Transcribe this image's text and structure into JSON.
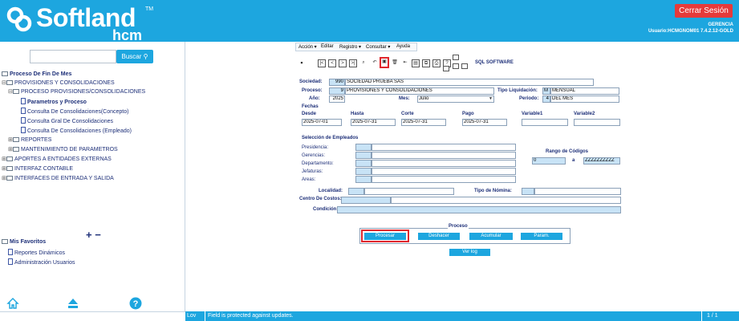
{
  "header": {
    "brand": "Softland",
    "tm": "TM",
    "sub_brand": "hcm",
    "logout_label": "Cerrar Sesión",
    "company": "GERENCIA",
    "user_info": "Usuario:HCMGNOM01 7.4.2.12-GOLD"
  },
  "sidebar": {
    "search_placeholder": "",
    "search_label": "Buscar",
    "tree": {
      "root": "Proceso De Fin De Mes",
      "n1": "PROVISIONES Y CONSOLIDACIONES",
      "n2": "PROCESO PROVISIONES/CONSOLIDACIONES",
      "n3": "Parametros y Proceso",
      "n4": "Consulta De Consolidaciones(Concepto)",
      "n5": "Consulta Gral De Consolidaciones",
      "n6": "Consulta De Consolidaciones (Empleado)",
      "n7": "REPORTES",
      "n8": "MANTENIMIENTO DE PARAMETROS",
      "n9": "APORTES A ENTIDADES EXTERNAS",
      "n10": "INTERFAZ CONTABLE",
      "n11": "INTERFACES DE ENTRADA Y SALIDA"
    },
    "plus_minus": "+ −",
    "favorites": {
      "title": "Mis Favoritos",
      "f1": "Reportes Dinámicos",
      "f2": "Administración Usuarios"
    }
  },
  "menubar": {
    "m1": "Acción",
    "m2": "Editar",
    "m3": "Registro",
    "m4": "Consultar",
    "m5": "Ayuda"
  },
  "toolbar": {
    "sql_label": "SQL SOFTWARE"
  },
  "form": {
    "sociedad_label": "Sociedad:",
    "sociedad_code": "990",
    "sociedad_name": "SOCIEDAD PRUEBA SAS",
    "proceso_label": "Proceso:",
    "proceso_code": "9",
    "proceso_name": "PROVISIONES Y CONSOLIDACIONES",
    "tipo_liq_label": "Tipo Liquidación:",
    "tipo_liq_code": "M",
    "tipo_liq_name": "MENSUAL",
    "anio_label": "Año:",
    "anio_value": "2025",
    "mes_label": "Mes:",
    "mes_value": "Julio",
    "periodo_label": "Periodo:",
    "periodo_code": "4",
    "periodo_name": "DEL MES",
    "fechas_label": "Fechas",
    "desde_label": "Desde",
    "desde_value": "2025-07-01",
    "hasta_label": "Hasta",
    "hasta_value": "2025-07-31",
    "corte_label": "Corte",
    "corte_value": "2025-07-31",
    "pago_label": "Pago",
    "pago_value": "2025-07-31",
    "var1_label": "Variable1",
    "var2_label": "Variable2",
    "seleccion_label": "Selección de Empleados",
    "presidencia_label": "Presidencia:",
    "gerencias_label": "Gerencias:",
    "departamento_label": "Departamento:",
    "jefaturas_label": "Jefaturas:",
    "areas_label": "Areas:",
    "rango_label": "Rango de Códigos",
    "rango_desde": "0",
    "rango_a": "a",
    "rango_hasta": "ZZZZZZZZZZ",
    "localidad_label": "Localidad:",
    "tipo_nomina_label": "Tipo de Nómina:",
    "centro_label": "Centro De Costos:",
    "condicion_label": "Condición:"
  },
  "process": {
    "title": "Proceso",
    "procesar": "Procesar",
    "deshacer": "Deshacer",
    "acumular": "Acumular",
    "param": "Param.",
    "ver_log": "Ver log"
  },
  "status": {
    "lov": "Lov",
    "message": "Field is protected against updates.",
    "page": "1 / 1"
  },
  "colors": {
    "accent": "#1da6df",
    "logout": "#e63a3a",
    "highlight": "#e0282e",
    "tree_text": "#1d2f78"
  }
}
